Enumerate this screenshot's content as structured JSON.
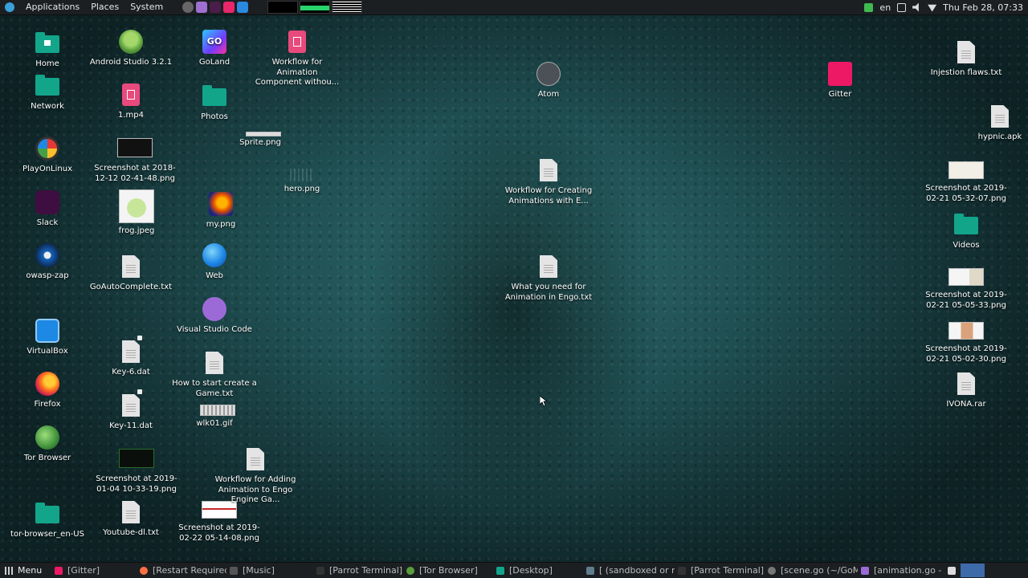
{
  "top_panel": {
    "menus": [
      "Applications",
      "Places",
      "System"
    ],
    "keyboard_layout": "en",
    "clock": "Thu Feb 28, 07:33"
  },
  "desktop_icons": [
    {
      "label": "Home",
      "kind": "folder"
    },
    {
      "label": "Network",
      "kind": "folder"
    },
    {
      "label": "PlayOnLinux",
      "kind": "app"
    },
    {
      "label": "Slack",
      "kind": "app"
    },
    {
      "label": "owasp-zap",
      "kind": "app"
    },
    {
      "label": "VirtualBox",
      "kind": "app"
    },
    {
      "label": "Firefox",
      "kind": "app"
    },
    {
      "label": "Tor Browser",
      "kind": "app"
    },
    {
      "label": "tor-browser_en-US",
      "kind": "folder"
    },
    {
      "label": "Android Studio 3.2.1",
      "kind": "app"
    },
    {
      "label": "1.mp4",
      "kind": "video"
    },
    {
      "label": "Screenshot at 2018-12-12 02-41-48.png",
      "kind": "image"
    },
    {
      "label": "frog.jpeg",
      "kind": "image"
    },
    {
      "label": "GoAutoComplete.txt",
      "kind": "text"
    },
    {
      "label": "Key-6.dat",
      "kind": "data"
    },
    {
      "label": "Key-11.dat",
      "kind": "data"
    },
    {
      "label": "Screenshot at 2019-01-04 10-33-19.png",
      "kind": "image"
    },
    {
      "label": "Youtube-dl.txt",
      "kind": "text"
    },
    {
      "label": "GoLand",
      "kind": "app"
    },
    {
      "label": "Photos",
      "kind": "folder"
    },
    {
      "label": "my.png",
      "kind": "image"
    },
    {
      "label": "Web",
      "kind": "app"
    },
    {
      "label": "Visual Studio Code",
      "kind": "app"
    },
    {
      "label": "How to start create a Game.txt",
      "kind": "text"
    },
    {
      "label": "wlk01.gif",
      "kind": "image"
    },
    {
      "label": "Screenshot at 2019-02-22 05-14-08.png",
      "kind": "image"
    },
    {
      "label": "Workflow for Animation Component withou...",
      "kind": "video"
    },
    {
      "label": "Sprite.png",
      "kind": "image"
    },
    {
      "label": "hero.png",
      "kind": "image"
    },
    {
      "label": "Workflow for Adding Animation to Engo Engine Ga...",
      "kind": "text"
    },
    {
      "label": "Atom",
      "kind": "app"
    },
    {
      "label": "Workflow for Creating Animations with E...",
      "kind": "text"
    },
    {
      "label": "What you need for Animation in Engo.txt",
      "kind": "text"
    },
    {
      "label": "Gitter",
      "kind": "app"
    },
    {
      "label": "Injestion flaws.txt",
      "kind": "text"
    },
    {
      "label": "hypnic.apk",
      "kind": "package"
    },
    {
      "label": "Screenshot at 2019-02-21 05-32-07.png",
      "kind": "image"
    },
    {
      "label": "Videos",
      "kind": "folder"
    },
    {
      "label": "Screenshot at 2019-02-21 05-05-33.png",
      "kind": "image"
    },
    {
      "label": "Screenshot at 2019-02-21 05-02-30.png",
      "kind": "image"
    },
    {
      "label": "IVONA.rar",
      "kind": "archive"
    }
  ],
  "taskbar": {
    "menu_label": "Menu",
    "items": [
      "[Gitter]",
      "[Restart Required ...",
      "[Music]",
      "[Parrot Terminal]",
      "[Tor Browser]",
      "[Desktop]",
      "[ (sandboxed or ro...",
      "[Parrot Terminal]",
      "[scene.go (~/GoM...",
      "[animation.go - /h..."
    ]
  },
  "colors": {
    "panel_bg": "#1b1f22",
    "folder": "#12a58a",
    "workspace_active": "#3d6aa8"
  }
}
